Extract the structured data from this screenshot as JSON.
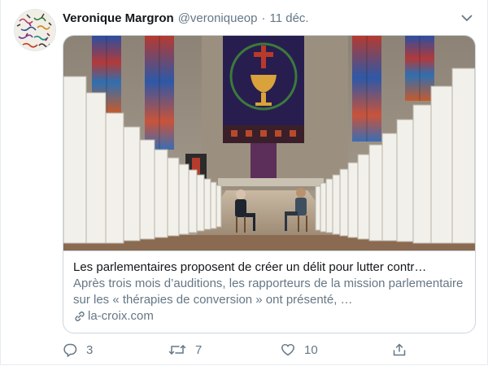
{
  "tweet": {
    "author_name": "Veronique Margron",
    "handle": "@veroniqueop",
    "separator": "·",
    "date": "11 déc."
  },
  "card": {
    "title": "Les parlementaires proposent de créer un délit pour lutter contr…",
    "description": "Après trois mois d’auditions, les rapporteurs de la mission parlementaire sur les « thérapies de conversion » ont présenté, …",
    "domain": "la-croix.com"
  },
  "actions": {
    "reply_count": "3",
    "retweet_count": "7",
    "like_count": "10"
  },
  "icons": {
    "more": "chevron-down-icon",
    "link": "link-icon",
    "reply": "reply-icon",
    "retweet": "retweet-icon",
    "like": "heart-icon",
    "share": "share-icon"
  },
  "colors": {
    "text": "#14171a",
    "secondary": "#657786",
    "border": "#ccd6dd"
  }
}
